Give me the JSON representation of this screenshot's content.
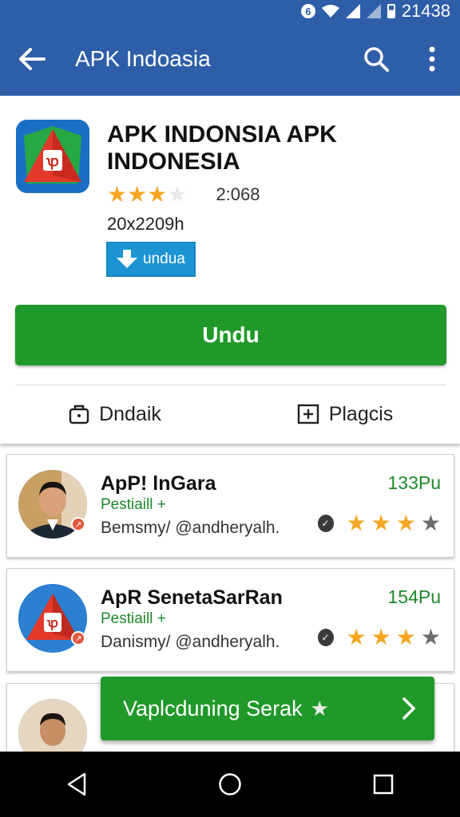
{
  "status_bar": {
    "time": "21438",
    "notification_glyph": "6"
  },
  "app_bar": {
    "title": "APK Indoasia"
  },
  "app": {
    "name": "APK INDONSIA APK INDONESIA",
    "rating_stars": 3,
    "rating_count": "2:068",
    "size": "20x2209h",
    "small_button_label": "undua",
    "install_button_label": "Undu"
  },
  "tabs": [
    {
      "label": "Dndaik",
      "icon": "briefcase-icon"
    },
    {
      "label": "Plagcis",
      "icon": "plus-box-icon"
    }
  ],
  "list_items": [
    {
      "name": "ApP! lnGara",
      "price": "133Pu",
      "subtitle": "Pestiaill +",
      "description": "Bemsmy/ @andheryalh.",
      "stars": 3,
      "avatar": "person"
    },
    {
      "name": "ApR SenetaSarRan",
      "price": "154Pu",
      "subtitle": "Pestiaill +",
      "description": "Danismy/ @andheryalh.",
      "stars": 3,
      "avatar": "app-logo"
    },
    {
      "name": "",
      "price": "",
      "subtitle": "",
      "description": "",
      "stars": 0,
      "avatar": "person"
    }
  ],
  "snackbar": {
    "label": "Vaplcduning Serak"
  },
  "colors": {
    "primary": "#2f5ea8",
    "green": "#20992a",
    "star": "#f5a623",
    "blue_button": "#1c94d2"
  }
}
